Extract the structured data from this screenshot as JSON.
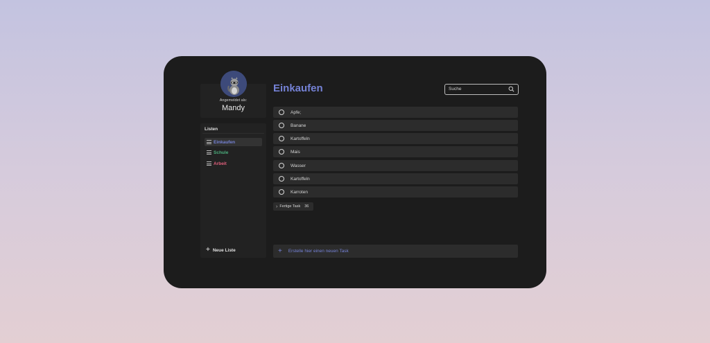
{
  "sidebar": {
    "profile": {
      "signed_in_label": "Angemeldet als:",
      "user_name": "Mandy",
      "avatar_icon": "raccoon-avatar"
    },
    "lists_header": "Listen",
    "lists": [
      {
        "label": "Einkaufen",
        "color": "#7582d6",
        "active": true
      },
      {
        "label": "Schule",
        "color": "#4caf7d",
        "active": false
      },
      {
        "label": "Arbeit",
        "color": "#e0607c",
        "active": false
      }
    ],
    "new_list_label": "Neue Liste"
  },
  "main": {
    "title": "Einkaufen",
    "search": {
      "placeholder": "Suche"
    },
    "tasks": [
      {
        "label": "Apfe;"
      },
      {
        "label": "Banane"
      },
      {
        "label": "Kartoffeln"
      },
      {
        "label": "Mais"
      },
      {
        "label": "Wasser"
      },
      {
        "label": "Kartoffeln"
      },
      {
        "label": "Karroten"
      }
    ],
    "done_toggle": {
      "label": "Fertige Task",
      "count": "36"
    },
    "new_task_placeholder": "Erstelle hier einen neuen Task"
  },
  "colors": {
    "accent": "#7582d6",
    "window_bg": "#1c1c1c",
    "row_bg": "#2c2c2c"
  }
}
